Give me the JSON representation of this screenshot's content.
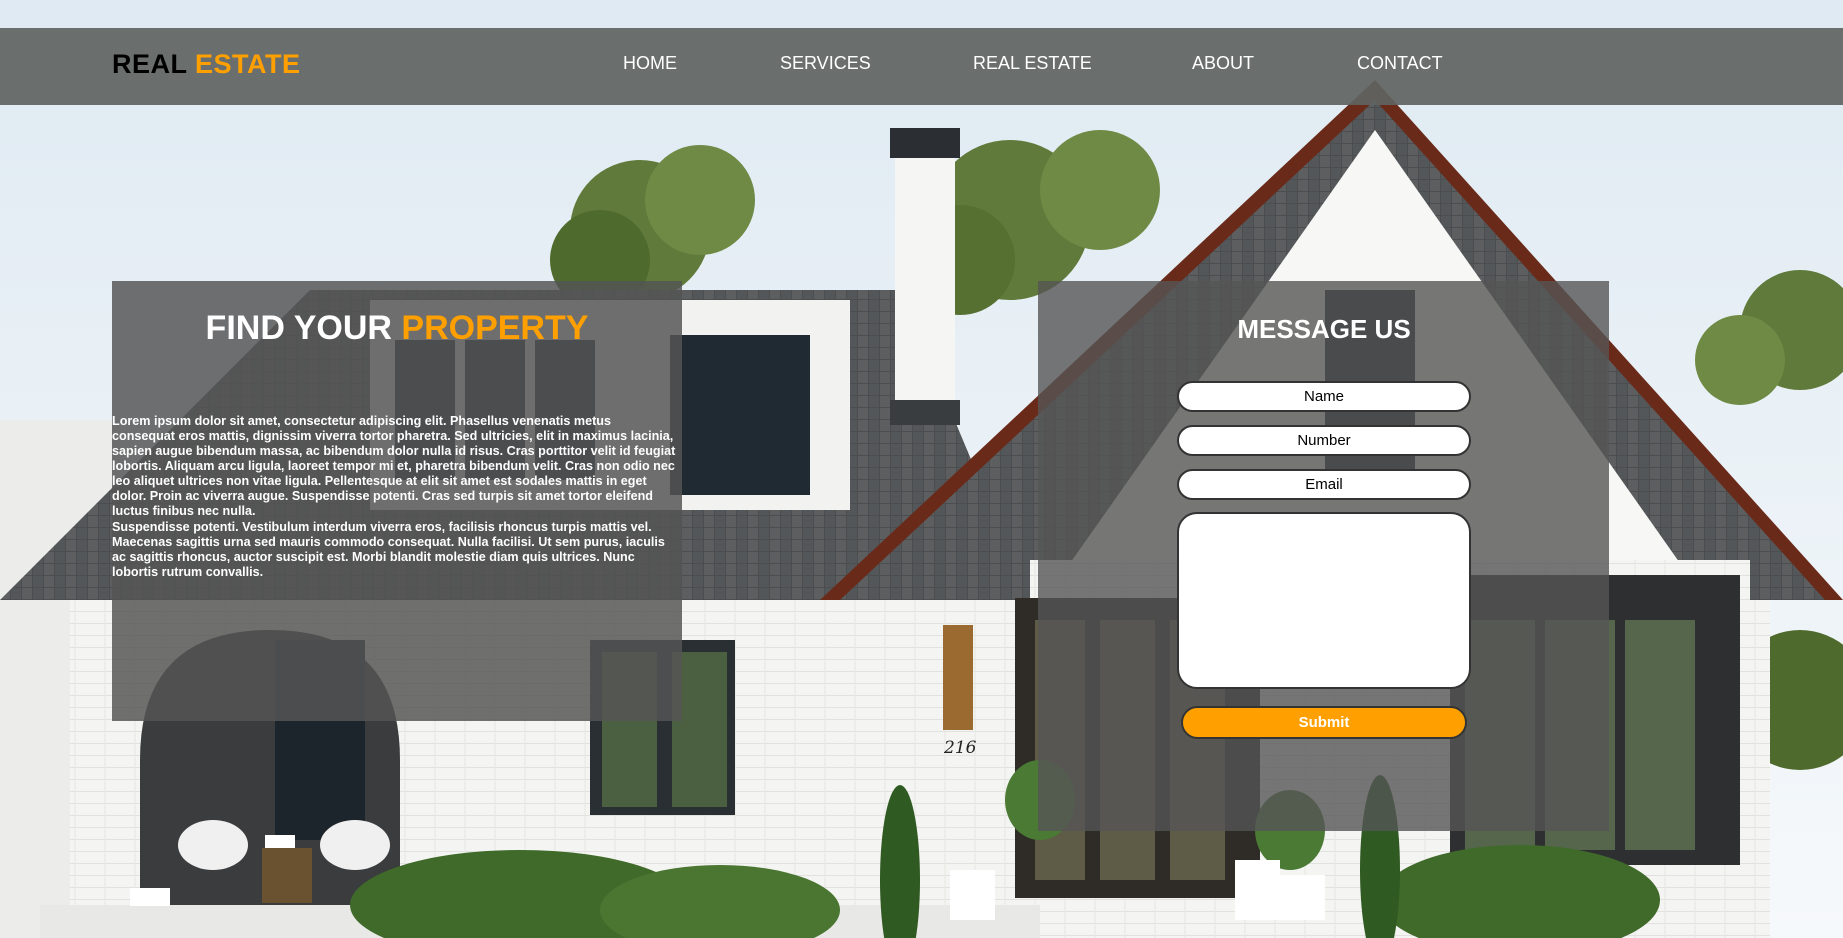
{
  "header": {
    "logo_part1": "REAL",
    "logo_part2": "ESTATE",
    "nav": [
      "HOME",
      "SERVICES",
      "REAL ESTATE",
      "ABOUT",
      "CONTACT"
    ]
  },
  "hero": {
    "title_part1": "FIND YOUR",
    "title_part2": "PROPERTY",
    "paragraph1": "Lorem ipsum dolor sit amet, consectetur adipiscing elit. Phasellus venenatis metus consequat eros mattis, dignissim viverra tortor pharetra. Sed ultricies, elit in maximus lacinia, sapien augue bibendum massa, ac bibendum dolor nulla id risus. Cras porttitor velit id feugiat lobortis. Aliquam arcu ligula, laoreet tempor mi et, pharetra bibendum velit. Cras non odio nec leo aliquet ultrices non vitae ligula. Pellentesque at elit sit amet est sodales mattis in eget dolor. Proin ac viverra augue. Suspendisse potenti. Cras sed turpis sit amet tortor eleifend luctus finibus nec nulla.",
    "paragraph2": "Suspendisse potenti. Vestibulum interdum viverra eros, facilisis rhoncus turpis mattis vel. Maecenas sagittis urna sed mauris commodo consequat. Nulla facilisi. Ut sem purus, iaculis ac sagittis rhoncus, auctor suscipit est. Morbi blandit molestie diam quis ultrices. Nunc lobortis rutrum convallis.",
    "house_number": "216"
  },
  "contact_form": {
    "title": "MESSAGE US",
    "name_placeholder": "Name",
    "number_placeholder": "Number",
    "email_placeholder": "Email",
    "message_placeholder": "",
    "submit_label": "Submit"
  },
  "colors": {
    "accent": "#ffa000",
    "nav_bar": "#606462",
    "panel": "#555555",
    "text_light": "#ffffff"
  }
}
